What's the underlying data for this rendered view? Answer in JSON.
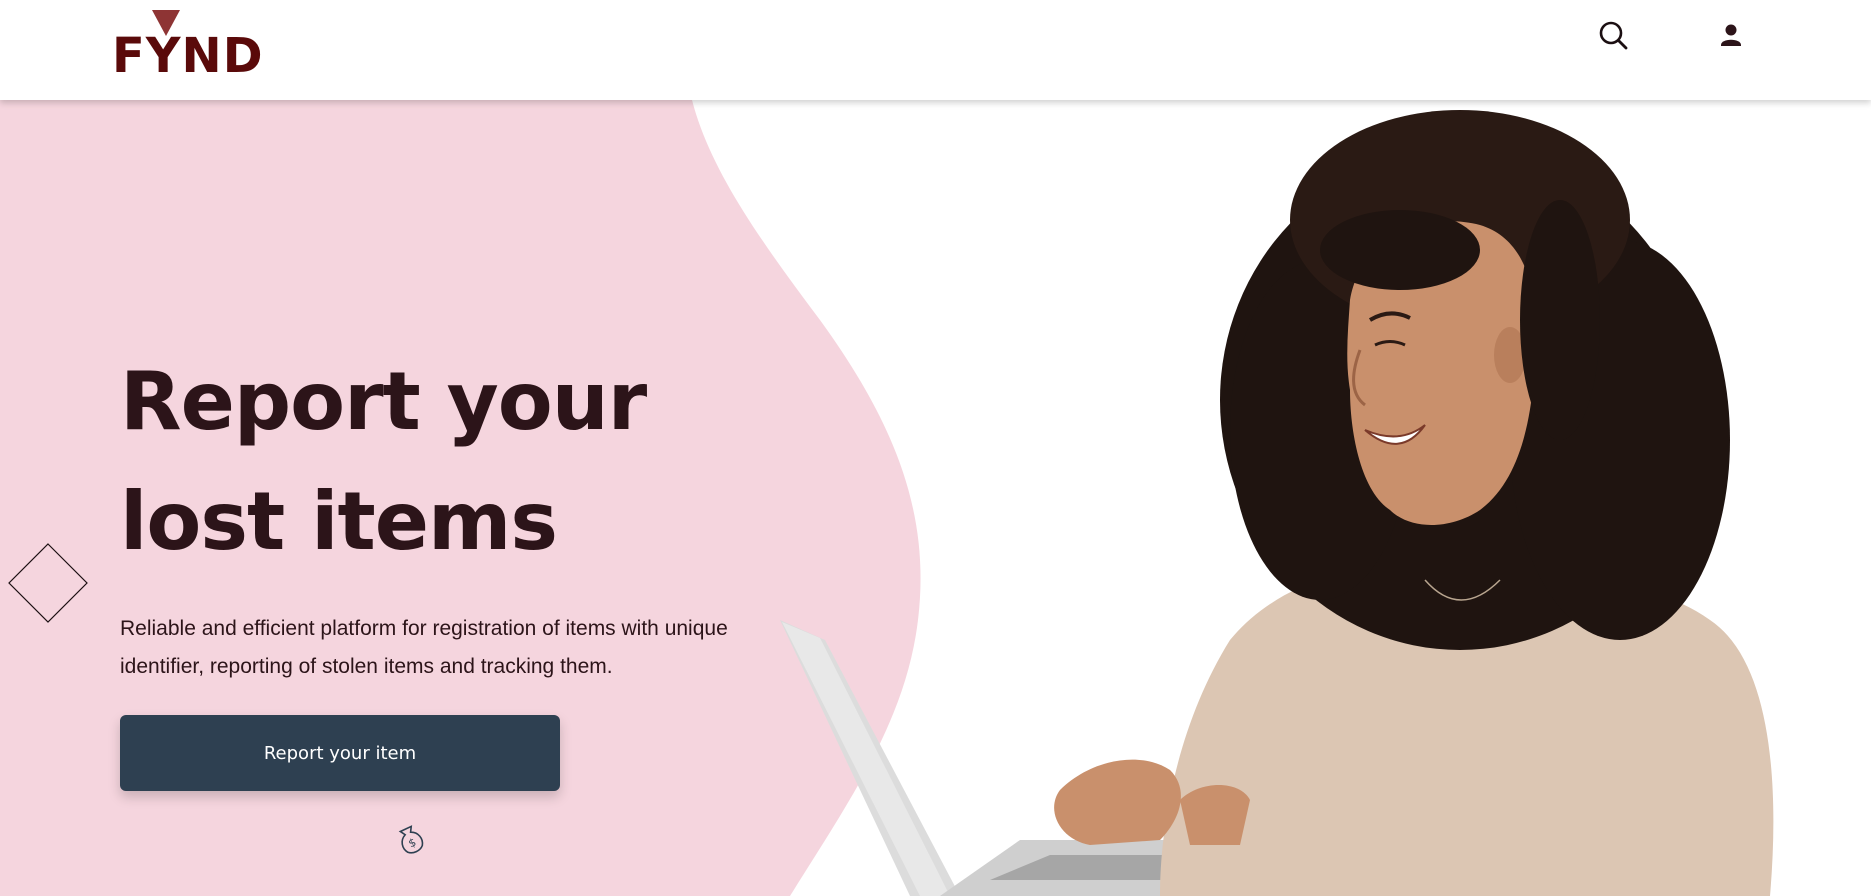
{
  "header": {
    "logo_text": "FYND",
    "icons": {
      "search": "search-icon",
      "user": "user-icon"
    }
  },
  "hero": {
    "headline": "Report your lost items",
    "subtext": "Reliable and efficient platform for registration of items with unique identifier, reporting of stolen items and tracking them.",
    "cta_label": "Report your item"
  },
  "colors": {
    "brand": "#5a0a0a",
    "blob": "#f5d5de",
    "text": "#2c1419",
    "button": "#2e4051"
  }
}
